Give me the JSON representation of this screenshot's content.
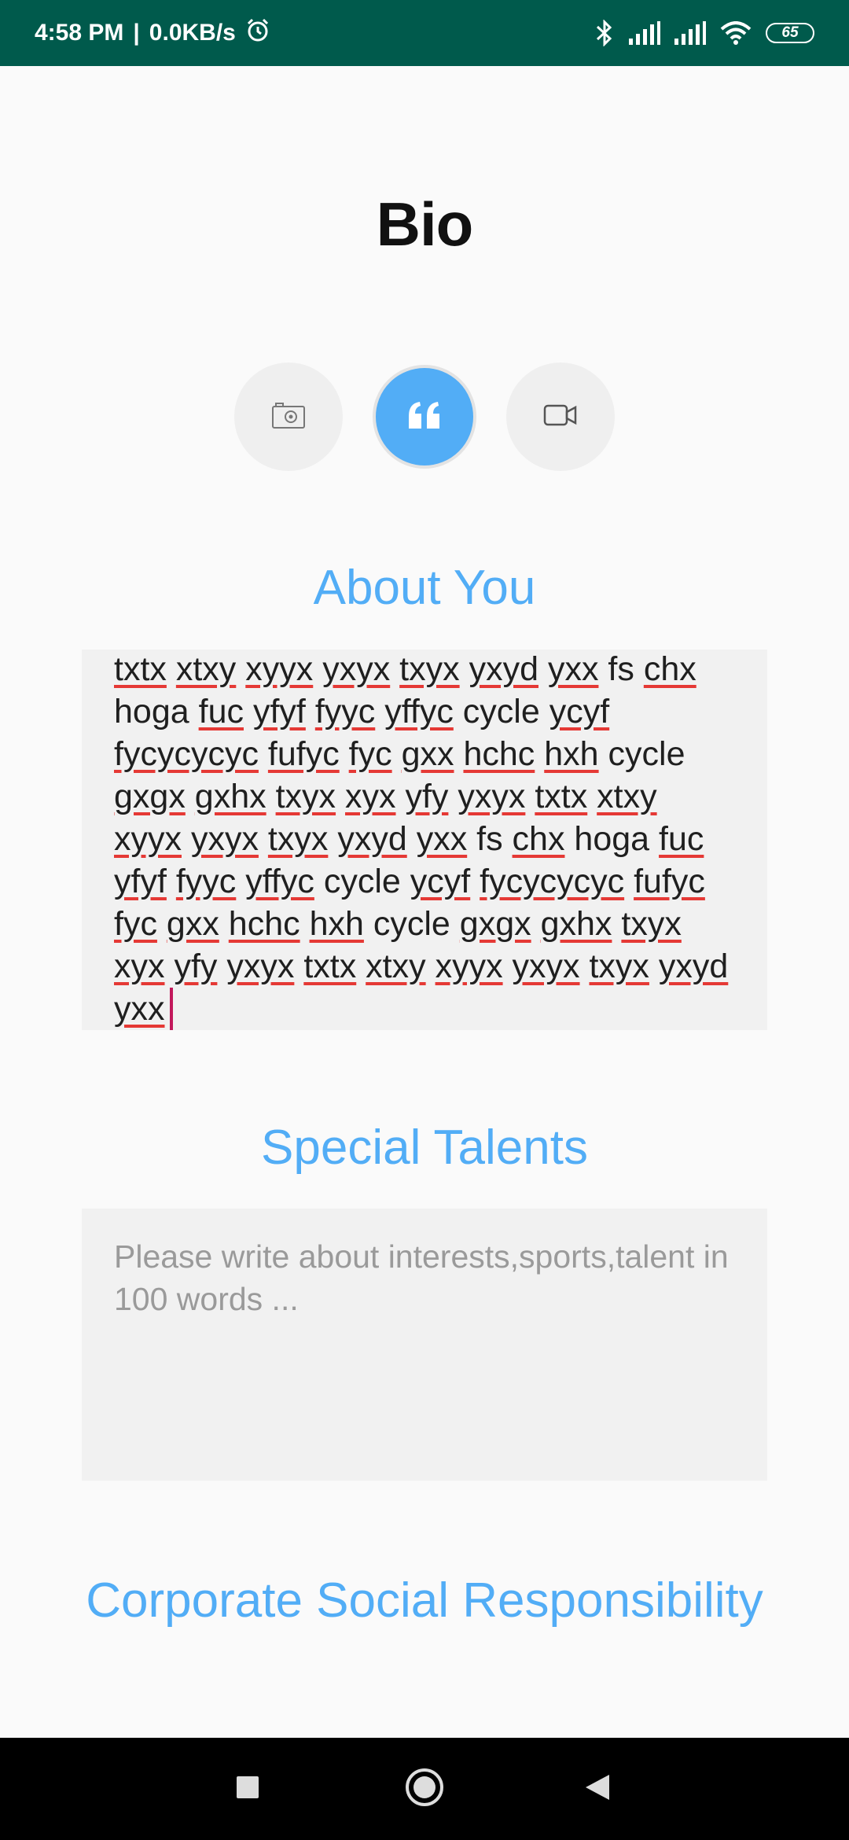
{
  "status_bar": {
    "time": "4:58 PM",
    "network_speed": "0.0KB/s",
    "battery": "65",
    "icons": [
      "alarm-icon",
      "bluetooth-icon",
      "signal-icon",
      "signal-icon",
      "wifi-icon",
      "battery-icon"
    ]
  },
  "page": {
    "title": "Bio"
  },
  "mode_buttons": [
    {
      "icon": "camera-icon",
      "active": false
    },
    {
      "icon": "quote-icon",
      "active": true
    },
    {
      "icon": "video-icon",
      "active": false
    }
  ],
  "about": {
    "heading": "About You",
    "text_lines": [
      "txtx xtxy xyyx yxyx txyx yxyd yxx fs chx",
      "hoga fuc yfyf fyyc yffyc cycle ycyf",
      "fycycycyc fufyc fyc gxx hchc hxh cycle",
      "gxgx gxhx txyx xyx yfy yxyx txtx xtxy",
      "xyyx yxyx txyx yxyd yxx fs chx hoga fuc",
      "yfyf fyyc yffyc cycle ycyf fycycycyc fufyc",
      "fyc gxx hchc hxh cycle gxgx gxhx txyx",
      "xyx yfy yxyx txtx xtxy xyyx yxyx txyx yxyd",
      "yxx"
    ]
  },
  "talents": {
    "heading": "Special Talents",
    "placeholder": "Please write about interests,sports,talent in 100 words ..."
  },
  "csr": {
    "heading": "Corporate Social Responsibility"
  },
  "colors": {
    "status_bar": "#005a4c",
    "accent": "#52adf6",
    "spellcheck": "#e53935",
    "caret": "#c2185b"
  }
}
